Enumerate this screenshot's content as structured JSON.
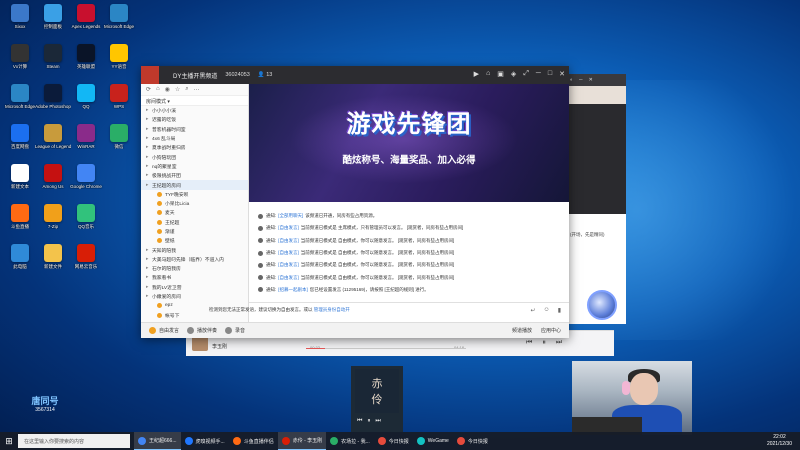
{
  "desktop": {
    "icons": [
      {
        "label": "Sixxx",
        "color": "#3b78c9"
      },
      {
        "label": "Vx计算",
        "color": "#333333"
      },
      {
        "label": "Microsoft Edge",
        "color": "#2b86c5"
      },
      {
        "label": "百度网盘",
        "color": "#1b6ff0"
      },
      {
        "label": "新建文本",
        "color": "#ffffff"
      },
      {
        "label": "斗鱼直播",
        "color": "#ff6a13"
      },
      {
        "label": "此电脑",
        "color": "#2f8ad8"
      },
      {
        "label": "控制面板",
        "color": "#3aa0e6"
      },
      {
        "label": "Steam",
        "color": "#1b2838"
      },
      {
        "label": "Adobe Photoshop",
        "color": "#0b1b3a"
      },
      {
        "label": "League of Legends",
        "color": "#c89b3c"
      },
      {
        "label": "Among Us",
        "color": "#c51111"
      },
      {
        "label": "7-Zip",
        "color": "#f1a01a"
      },
      {
        "label": "新建文件",
        "color": "#f3c34b"
      },
      {
        "label": "Apex Legends",
        "color": "#c8102e"
      },
      {
        "label": "英雄联盟",
        "color": "#0a1428"
      },
      {
        "label": "QQ",
        "color": "#12b7f5"
      },
      {
        "label": "WinRAR",
        "color": "#8a2b8a"
      },
      {
        "label": "Google Chrome",
        "color": "#4285f4"
      },
      {
        "label": "QQ音乐",
        "color": "#31c27c"
      },
      {
        "label": "网易云音乐",
        "color": "#d81e06"
      },
      {
        "label": "Microsoft Edge",
        "color": "#2b86c5"
      },
      {
        "label": "YY语音",
        "color": "#ffc600"
      },
      {
        "label": "WPS",
        "color": "#c8221c"
      },
      {
        "label": "微信",
        "color": "#2aae67"
      }
    ]
  },
  "app": {
    "title": "DY主播开黑频道",
    "room_id": "36024053",
    "online": "13",
    "sidebar": {
      "filter": "房间模式",
      "channels": [
        {
          "label": "小小小小溪",
          "type": "channel",
          "active": false
        },
        {
          "label": "迟露的吃饭",
          "type": "channel",
          "active": false
        },
        {
          "label": "普客机器时间室",
          "type": "channel",
          "active": false
        },
        {
          "label": "4x6 乱斗局",
          "type": "channel",
          "active": false
        },
        {
          "label": "夏季战时重归房",
          "type": "channel",
          "active": false
        },
        {
          "label": "小狗陪玩团",
          "type": "channel",
          "active": false
        },
        {
          "label": "nq的聚星室",
          "type": "channel",
          "active": false
        },
        {
          "label": "极限挑战开团",
          "type": "channel",
          "active": false
        },
        {
          "label": "王纪超的房间",
          "type": "channel",
          "active": true
        },
        {
          "label": "TYF晚安呗",
          "type": "user",
          "active": false
        },
        {
          "label": "小呆比Licia",
          "type": "user",
          "active": false
        },
        {
          "label": "麦天",
          "type": "user",
          "active": false
        },
        {
          "label": "王纪超",
          "type": "user",
          "active": false
        },
        {
          "label": "渐谨",
          "type": "user",
          "active": false
        },
        {
          "label": "壁纸",
          "type": "user",
          "active": false
        },
        {
          "label": "天知的陪我",
          "type": "channel",
          "active": false
        },
        {
          "label": "大美马超叼先锋（临界）不道入内",
          "type": "channel",
          "active": false
        },
        {
          "label": "石尔的陪我房",
          "type": "channel",
          "active": false
        },
        {
          "label": "我家看书",
          "type": "channel",
          "active": false
        },
        {
          "label": "我的LV近卫营",
          "type": "channel",
          "active": false
        },
        {
          "label": "小嫩爱的房间",
          "type": "channel",
          "active": false
        },
        {
          "label": "epz",
          "type": "user",
          "active": false
        },
        {
          "label": "帐号下",
          "type": "user",
          "active": false
        }
      ]
    },
    "banner": {
      "title": "游戏先锋团",
      "subtitle": "酷炫称号、海量奖品、加入必得"
    },
    "messages": [
      {
        "prefix": "通知:",
        "tag": "[全部用聊天]",
        "text": "该频道已开通，同房有些占用资源。"
      },
      {
        "prefix": "通知:",
        "tag": "[自由发言]",
        "text": "当前频道已模式是 主席模式，只有管理员可以发言。 [观赏者，同房有些占用房间]"
      },
      {
        "prefix": "通知:",
        "tag": "[自由发言]",
        "text": "当前频道已模式是 自由模式，你可以随意发言。 [观赏者，同房有些占用房间]"
      },
      {
        "prefix": "通知:",
        "tag": "[自由发言]",
        "text": "当前频道已模式是 自由模式，你可以随意发言。 [观赏者，同房有些占用房间]"
      },
      {
        "prefix": "通知:",
        "tag": "[自由发言]",
        "text": "当前频道已模式是 自由模式，你可以随意发言。 [观赏者，同房有些占用房间]"
      },
      {
        "prefix": "通知:",
        "tag": "[自由发言]",
        "text": "当前频道已模式是 自由模式，你可以随意发言。 [观赏者，同房有些占用房间]"
      },
      {
        "prefix": "通知:",
        "tag": "[招募一起剧本]",
        "text": "您已经设置发言 (11295169)，请按照 [王纪超的规则] 进行。"
      }
    ],
    "input_notice": "检测到您无法正常发语，建议切换为自由发言。或以",
    "input_link": "管理员身份自动开",
    "bottom_bar": {
      "left": [
        "自由发言",
        "播放伴奏",
        "录音"
      ],
      "right": [
        "频道播放",
        "应用中心"
      ]
    }
  },
  "music": {
    "artist": "李玉刚",
    "time_left": "00:33",
    "time_right": "04:18",
    "progress": 0.12
  },
  "album": {
    "line1": "赤",
    "line2": "伶"
  },
  "watermark": {
    "big": "唐同号",
    "small": "3567314"
  },
  "right_window": {
    "note": "(开场，先是精同)"
  },
  "taskbar": {
    "search_placeholder": "在这里输入你要搜索的内容",
    "apps": [
      {
        "label": "王纪超666...",
        "color": "#4285f4",
        "active": true
      },
      {
        "label": "虎嗅视频手...",
        "color": "#1f77ff",
        "active": false
      },
      {
        "label": "斗鱼直播伴侣",
        "color": "#ff6a13",
        "active": false
      },
      {
        "label": "赤伶 - 李玉刚",
        "color": "#d81e06",
        "active": true
      },
      {
        "label": "农场拉 - 我...",
        "color": "#2aae67",
        "active": false
      },
      {
        "label": "今日快报",
        "color": "#e64b3c",
        "active": false
      },
      {
        "label": "WeGame",
        "color": "#13c2c2",
        "active": false
      },
      {
        "label": "今日快报",
        "color": "#e64b3c",
        "active": false
      }
    ],
    "time": "22:02",
    "date": "2021/12/30"
  }
}
